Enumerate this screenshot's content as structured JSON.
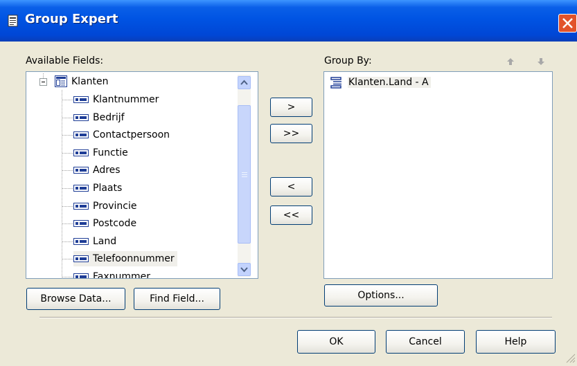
{
  "window": {
    "title": "Group Expert"
  },
  "available_fields": {
    "label": "Available Fields:",
    "root": "Klanten",
    "items": [
      "Klantnummer",
      "Bedrijf",
      "Contactpersoon",
      "Functie",
      "Adres",
      "Plaats",
      "Provincie",
      "Postcode",
      "Land",
      "Telefoonnummer",
      "Faxnummer"
    ],
    "hovered_item": "Telefoonnummer"
  },
  "transfer_buttons": {
    "add_one": ">",
    "add_all": ">>",
    "remove_one": "<",
    "remove_all": "<<"
  },
  "group_by": {
    "label": "Group By:",
    "items": [
      "Klanten.Land - A"
    ]
  },
  "buttons": {
    "browse_data": "Browse Data...",
    "find_field": "Find Field...",
    "options": "Options...",
    "ok": "OK",
    "cancel": "Cancel",
    "help": "Help"
  },
  "icons": {
    "title": "report-icon",
    "close": "close-icon",
    "move_up": "arrow-up-icon",
    "move_down": "arrow-down-icon"
  },
  "colors": {
    "titlebar": "#0054E3",
    "close_button": "#E2532B",
    "dialog_bg": "#ECE9D8",
    "list_border": "#7F9DB9"
  }
}
